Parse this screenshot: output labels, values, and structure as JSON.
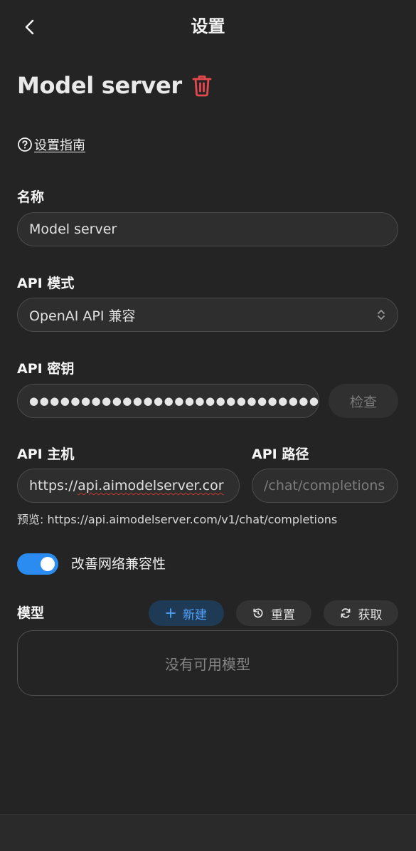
{
  "header": {
    "title": "设置"
  },
  "page": {
    "title": "Model server"
  },
  "guide": {
    "label": "设置指南"
  },
  "name_field": {
    "label": "名称",
    "value": "Model server"
  },
  "api_mode": {
    "label": "API 模式",
    "value": "OpenAI API 兼容"
  },
  "api_key": {
    "label": "API 密钥",
    "masked_value": "●●●●●●●●●●●●●●●●●●●●●●●●●●●●",
    "check_label": "检查"
  },
  "api_host": {
    "label": "API 主机",
    "value_prefix": "https://",
    "value_rest": "api.aimodelserver.cor"
  },
  "api_path": {
    "label": "API 路径",
    "placeholder": "/chat/completions"
  },
  "preview": {
    "text": "预览: https://api.aimodelserver.com/v1/chat/completions"
  },
  "compat_toggle": {
    "label": "改善网络兼容性",
    "on": true
  },
  "models": {
    "label": "模型",
    "new_label": "新建",
    "reset_label": "重置",
    "fetch_label": "获取",
    "empty_text": "没有可用模型"
  },
  "colors": {
    "accent": "#2a8cf0",
    "danger": "#e5484d",
    "background": "#242424"
  },
  "icons": [
    "back-chevron-icon",
    "trash-icon",
    "help-circle-icon",
    "select-arrows-icon",
    "eye-icon",
    "plus-icon",
    "reset-icon",
    "refresh-icon"
  ]
}
